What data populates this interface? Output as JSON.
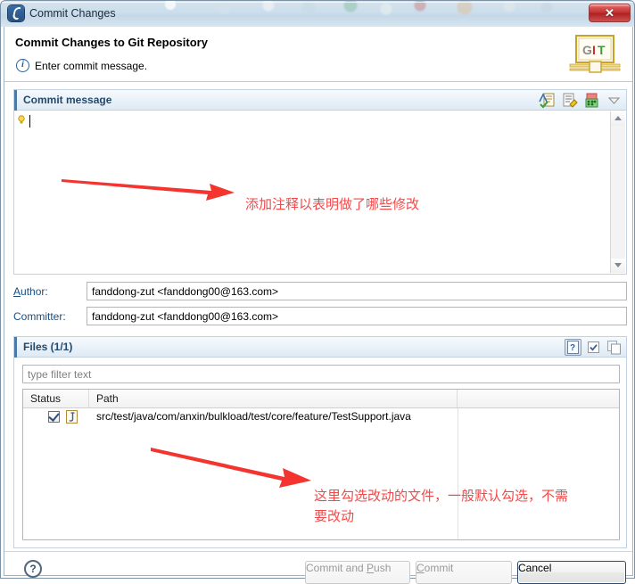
{
  "window": {
    "title": "Commit Changes",
    "app_icon": "eclipse-icon",
    "close_label": "✕"
  },
  "banner": {
    "title": "Commit Changes to Git Repository",
    "message": "Enter commit message.",
    "message_icon": "info-icon",
    "logo": {
      "name": "git-logo",
      "letters": [
        "G",
        "I",
        "T"
      ]
    }
  },
  "commit_message": {
    "group_title": "Commit message",
    "value": "",
    "toolbar": [
      {
        "name": "spell-check-icon",
        "label": "Spell check"
      },
      {
        "name": "sign-off-icon",
        "label": "Sign off"
      },
      {
        "name": "amend-icon",
        "label": "Amend previous commit"
      },
      {
        "name": "chevron-down-icon",
        "label": "More"
      }
    ]
  },
  "author": {
    "label_prefix": "A",
    "label_rest": "uthor:",
    "value": "fanddong-zut <fanddong00@163.com>"
  },
  "committer": {
    "label_prefix": "C",
    "label_rest": "ommitter:",
    "value": "fanddong-zut <fanddong00@163.com>"
  },
  "files": {
    "group_title": "Files (1/1)",
    "filter_placeholder": "type filter text",
    "filter_value": "",
    "toolbar": [
      {
        "name": "show-untracked-icon",
        "label": "?"
      },
      {
        "name": "select-all-icon",
        "label": "Select all"
      },
      {
        "name": "deselect-all-icon",
        "label": "Deselect all"
      }
    ],
    "columns": [
      "Status",
      "Path",
      ""
    ],
    "rows": [
      {
        "checked": true,
        "file_icon": "java-file-icon",
        "status": "",
        "path": "src/test/java/com/anxin/bulkload/test/core/feature/TestSupport.java"
      }
    ]
  },
  "footer": {
    "help_label": "?",
    "buttons": [
      {
        "name": "commit-and-push-button",
        "text_before": "Commit and ",
        "mnemonic": "P",
        "text_after": "ush",
        "enabled": false
      },
      {
        "name": "commit-button",
        "text_before": "",
        "mnemonic": "C",
        "text_after": "ommit",
        "enabled": false
      },
      {
        "name": "cancel-button",
        "text_before": "Cancel",
        "mnemonic": "",
        "text_after": "",
        "enabled": true
      }
    ]
  },
  "annotations": {
    "color": "#f24a4a",
    "note1": "添加注释以表明做了哪些修改",
    "note2_line1": "这里勾选改动的文件，一般默认勾选，不需",
    "note2_line2": "要改动",
    "arrows": [
      {
        "name": "annotation-arrow-top"
      },
      {
        "name": "annotation-arrow-bottom"
      }
    ]
  }
}
